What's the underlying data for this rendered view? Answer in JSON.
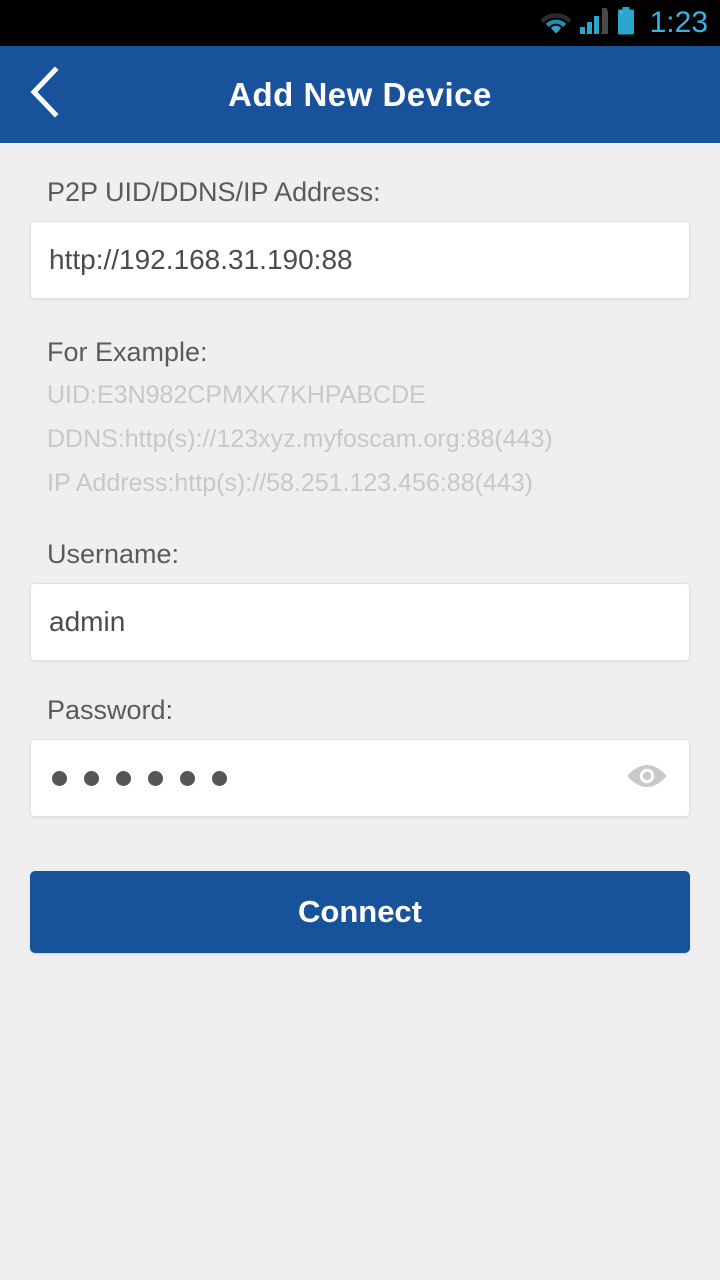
{
  "statusbar": {
    "time": "1:23",
    "icons": [
      "wifi-icon",
      "signal-icon",
      "battery-icon"
    ],
    "accent_color": "#33b5e5",
    "background_color": "#000000"
  },
  "header": {
    "title": "Add New Device",
    "back_icon": "chevron-left-icon",
    "background_color": "#17529b",
    "text_color": "#ffffff"
  },
  "form": {
    "address": {
      "label": "P2P UID/DDNS/IP Address:",
      "value": "http://192.168.31.190:88",
      "placeholder": ""
    },
    "example": {
      "title": "For Example:",
      "lines": [
        "UID:E3N982CPMXK7KHPABCDE",
        "DDNS:http(s)://123xyz.myfoscam.org:88(443)",
        "IP Address:http(s)://58.251.123.456:88(443)"
      ]
    },
    "username": {
      "label": "Username:",
      "value": "admin",
      "placeholder": ""
    },
    "password": {
      "label": "Password:",
      "value": "······",
      "masked_char_count": 6,
      "reveal_icon": "eye-icon"
    }
  },
  "actions": {
    "connect_label": "Connect",
    "connect_color": "#17529b"
  },
  "theme": {
    "page_background": "#efeff0",
    "label_color": "#5b5b5b",
    "hint_color": "#c8c8c8",
    "input_background": "#ffffff"
  }
}
